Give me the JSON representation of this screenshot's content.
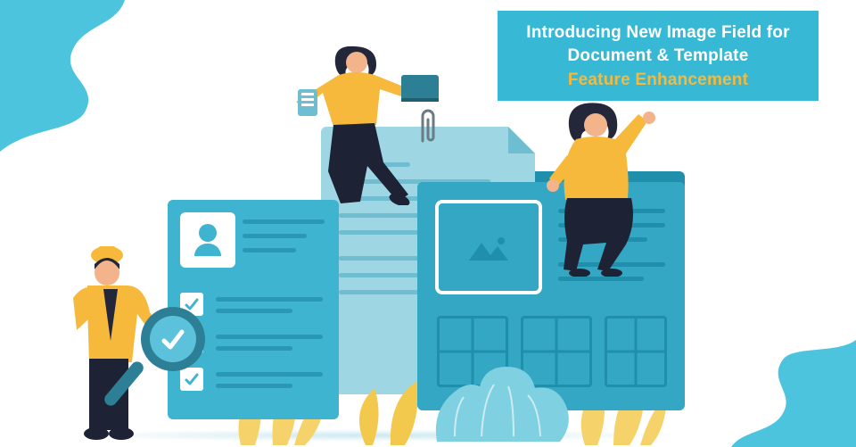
{
  "banner": {
    "line1": "Introducing New Image Field for",
    "line2": "Document & Template",
    "accent": "Feature Enhancement"
  },
  "colors": {
    "primary": "#37b9d6",
    "primary_dark": "#1f8fac",
    "primary_mid": "#3fb4d0",
    "primary_pale": "#9ed7e3",
    "accent_yellow": "#f6b93b",
    "skin": "#f3b48b",
    "hair": "#24273a",
    "pants": "#1e2235"
  },
  "scene": {
    "paperclip": "paperclip-icon",
    "checkbox_state": "checked",
    "magnifier": "magnifying-glass-icon",
    "image_placeholder": "mountain-photo-icon"
  }
}
